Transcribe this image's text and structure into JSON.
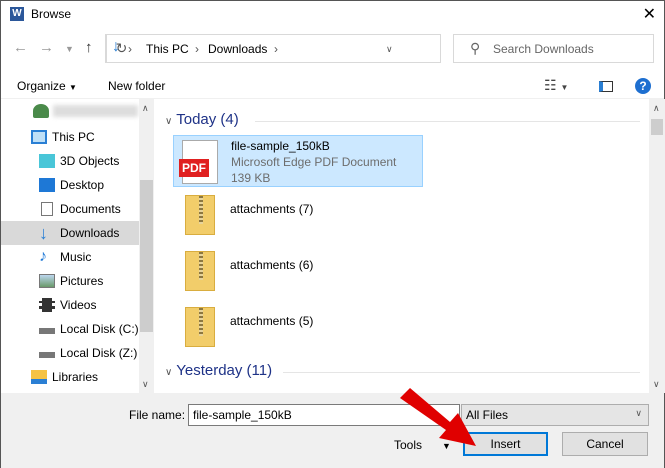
{
  "window": {
    "title": "Browse",
    "app_icon": "W"
  },
  "address": {
    "path": [
      "This PC",
      "Downloads"
    ],
    "search_placeholder": "Search Downloads"
  },
  "toolbar": {
    "organize": "Organize",
    "new_folder": "New folder"
  },
  "nav": {
    "items": [
      {
        "label": "",
        "icon": "user-icon",
        "blurred": true
      },
      {
        "label": "This PC",
        "icon": "pc-icon"
      },
      {
        "label": "3D Objects",
        "icon": "cube-icon"
      },
      {
        "label": "Desktop",
        "icon": "desktop-icon"
      },
      {
        "label": "Documents",
        "icon": "documents-icon"
      },
      {
        "label": "Downloads",
        "icon": "download-icon",
        "selected": true
      },
      {
        "label": "Music",
        "icon": "music-icon"
      },
      {
        "label": "Pictures",
        "icon": "pictures-icon"
      },
      {
        "label": "Videos",
        "icon": "videos-icon"
      },
      {
        "label": "Local Disk (C:)",
        "icon": "disk-icon"
      },
      {
        "label": "Local Disk (Z:)",
        "icon": "disk-icon"
      },
      {
        "label": "Libraries",
        "icon": "libraries-icon"
      }
    ]
  },
  "content": {
    "groups": [
      {
        "label": "Today (4)"
      },
      {
        "label": "Yesterday (11)"
      }
    ],
    "files": [
      {
        "name": "file-sample_150kB",
        "type": "Microsoft Edge PDF Document",
        "size": "139 KB",
        "icon_text": "PDF"
      },
      {
        "name": "attachments (7)"
      },
      {
        "name": "attachments (6)"
      },
      {
        "name": "attachments (5)"
      }
    ]
  },
  "bottom": {
    "file_name_label": "File name:",
    "file_name_value": "file-sample_150kB",
    "filter": "All Files",
    "tools": "Tools",
    "insert": "Insert",
    "cancel": "Cancel"
  },
  "colors": {
    "accent": "#0078d7",
    "selection": "#cce8ff",
    "arrow": "#e00000"
  }
}
